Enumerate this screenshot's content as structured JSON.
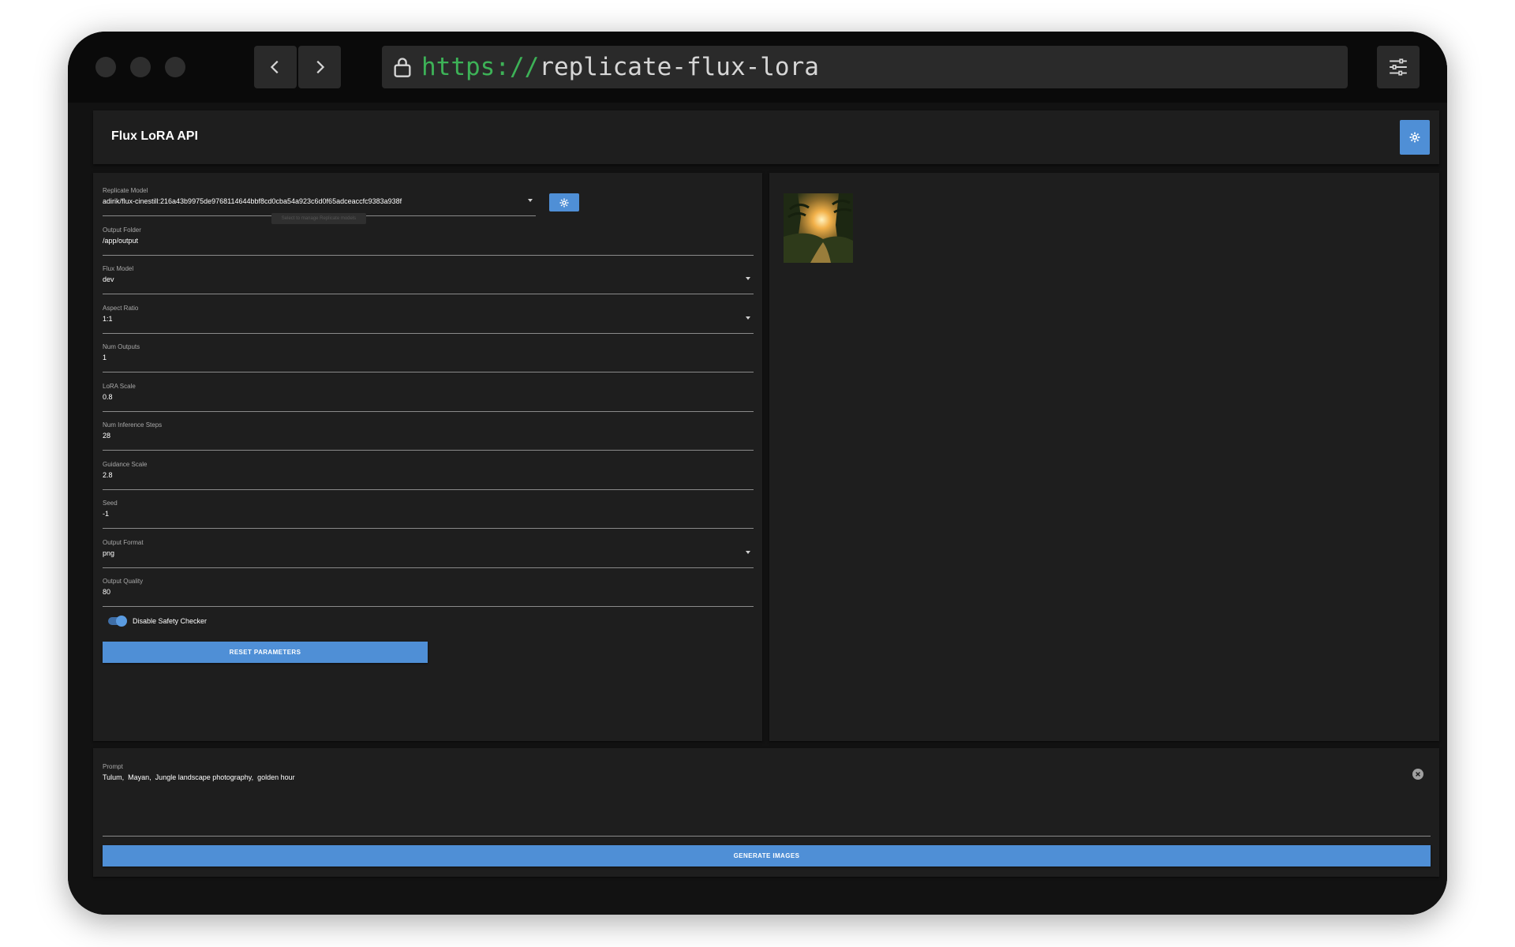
{
  "browser": {
    "url_scheme": "https://",
    "url_host": "replicate-flux-lora",
    "back_icon": "chevron-left-icon",
    "forward_icon": "chevron-right-icon",
    "lock_icon": "lock-icon",
    "menu_icon": "sliders-icon"
  },
  "app": {
    "title": "Flux LoRA API",
    "settings_icon": "gear-icon",
    "accent": "#4f8fd6"
  },
  "params": {
    "replicate_model": {
      "label": "Replicate Model",
      "value": "adirik/flux-cinestill:216a43b9975de9768114644bbf8cd0cba54a923c6d0f65adceaccfc9383a938f",
      "tooltip": "Select to manage Replicate models"
    },
    "output_folder": {
      "label": "Output Folder",
      "value": "/app/output"
    },
    "flux_model": {
      "label": "Flux Model",
      "value": "dev"
    },
    "aspect_ratio": {
      "label": "Aspect Ratio",
      "value": "1:1"
    },
    "num_outputs": {
      "label": "Num Outputs",
      "value": "1"
    },
    "lora_scale": {
      "label": "LoRA Scale",
      "value": "0.8"
    },
    "num_inference_steps": {
      "label": "Num Inference Steps",
      "value": "28"
    },
    "guidance_scale": {
      "label": "Guidance Scale",
      "value": "2.8"
    },
    "seed": {
      "label": "Seed",
      "value": "-1"
    },
    "output_format": {
      "label": "Output Format",
      "value": "png"
    },
    "output_quality": {
      "label": "Output Quality",
      "value": "80"
    },
    "disable_safety_checker": {
      "label": "Disable Safety Checker",
      "checked": true
    },
    "reset_label": "RESET PARAMETERS"
  },
  "gallery": {
    "images": [
      {
        "alt": "jungle-sunset-thumbnail"
      }
    ]
  },
  "prompt": {
    "label": "Prompt",
    "value": "Tulum,  Mayan,  Jungle landscape photography,  golden hour",
    "clear_icon": "clear-icon",
    "generate_label": "GENERATE IMAGES"
  }
}
